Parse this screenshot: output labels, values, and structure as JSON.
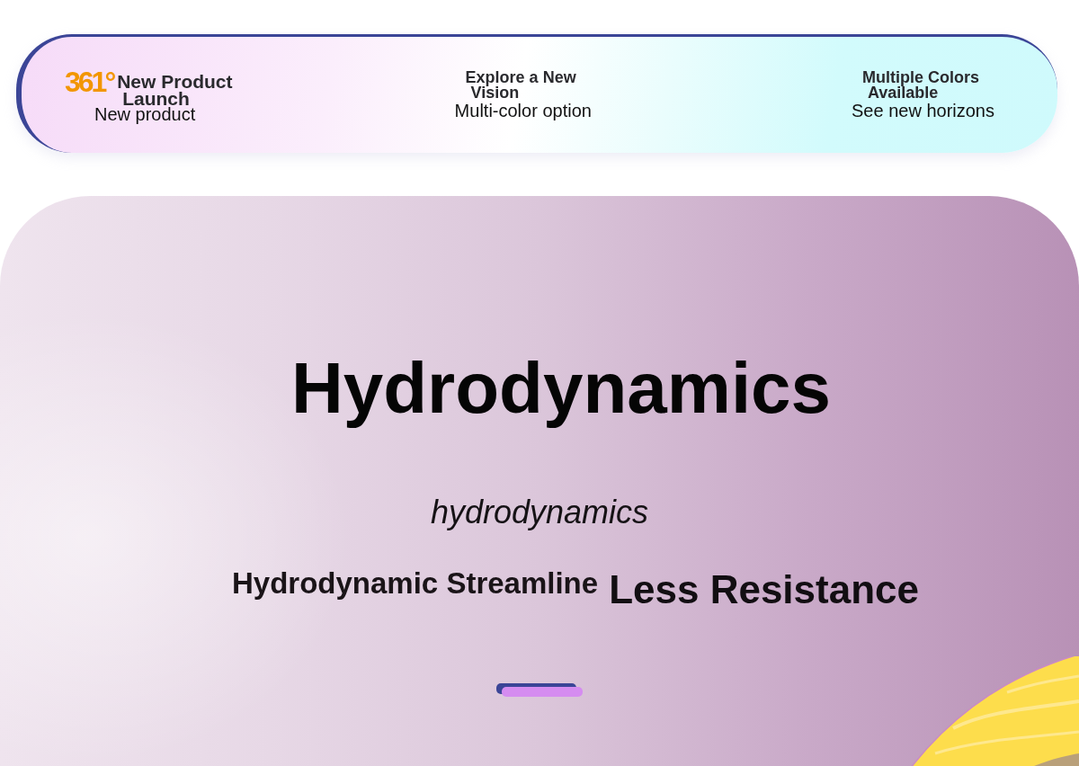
{
  "banner": {
    "items": [
      {
        "logo": "361°",
        "title": "New Product Launch",
        "subtitle": "New product"
      },
      {
        "title": "Explore a New Vision",
        "subtitle": "Multi-color option"
      },
      {
        "title": "Multiple Colors Available",
        "subtitle": "See new horizons"
      }
    ]
  },
  "hero": {
    "title": "Hydrodynamics",
    "subtitle": "hydrodynamics",
    "features": [
      {
        "kind": "label",
        "text": "Hydrodynamic Streamline"
      },
      {
        "kind": "headline",
        "text": "Less Resistance"
      }
    ]
  }
}
